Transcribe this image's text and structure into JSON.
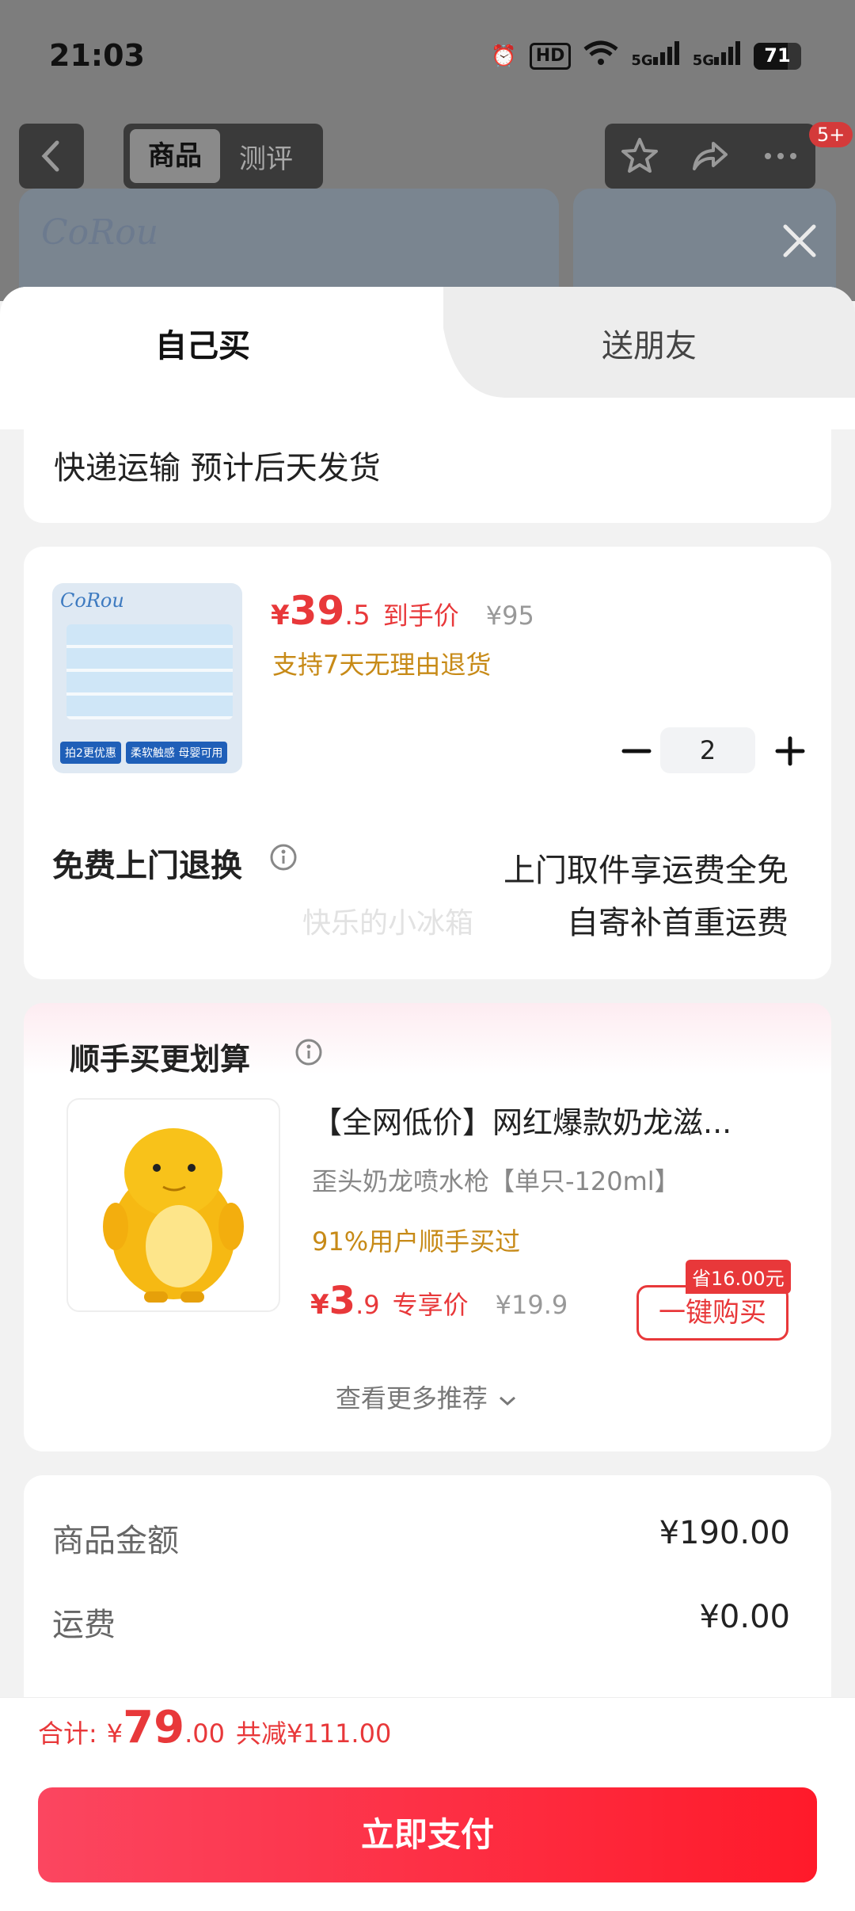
{
  "status_bar": {
    "time": "21:03",
    "hd": "HD",
    "net1": "5G",
    "net2": "5G",
    "battery": "71",
    "battery_level": 0.71
  },
  "header": {
    "seg_goods": "商品",
    "seg_review": "测评",
    "badge": "5+"
  },
  "tabs": {
    "self": "自己买",
    "gift": "送朋友"
  },
  "shipping": {
    "text": "快递运输 预计后天发货"
  },
  "product": {
    "price_symbol": "¥",
    "price_int": "39",
    "price_dec": ".5",
    "price_tag": "到手价",
    "orig_price": "¥95",
    "return_policy": "支持7天无理由退货",
    "quantity": "2",
    "thumb_brand": "CoRou",
    "thumb_tag1": "拍2更优惠",
    "thumb_tag2": "柔软触感 母婴可用"
  },
  "free_return": {
    "title": "免费上门退换",
    "line1": "上门取件享运费全免",
    "line2": "自寄补首重运费",
    "watermark": "快乐的小冰箱"
  },
  "recommend": {
    "title": "顺手买更划算",
    "item_title": "【全网低价】网红爆款奶龙滋...",
    "item_spec": "歪头奶龙喷水枪【单只-120ml】",
    "item_social": "91%用户顺手买过",
    "price_symbol": "¥",
    "price_int": "3",
    "price_dec": ".9",
    "price_tag": "专享价",
    "orig_price": "¥19.9",
    "save_badge": "省16.00元",
    "buy_button": "一键购买",
    "more": "查看更多推荐"
  },
  "summary": {
    "goods_label": "商品金额",
    "goods_value": "¥190.00",
    "shipping_label": "运费",
    "shipping_value": "¥0.00"
  },
  "footer": {
    "total_label": "合计:",
    "total_symbol": "¥",
    "total_int": "79",
    "total_dec": ".00",
    "discount": "共减¥111.00",
    "pay_button": "立即支付"
  },
  "colors": {
    "accent": "#e8383a",
    "orange": "#c78a17",
    "pay_start": "#fb4660",
    "pay_end": "#ff1a2a"
  }
}
